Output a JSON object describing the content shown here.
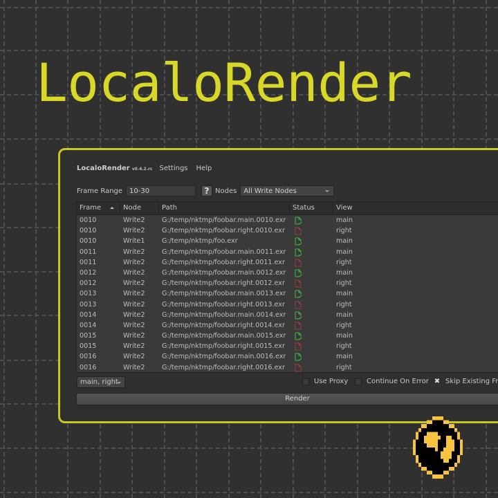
{
  "hero": {
    "title": "LocaloRender"
  },
  "menubar": {
    "app_name": "LocaloRender",
    "version": "v0.4.2.rc",
    "items": [
      "Settings",
      "Help"
    ]
  },
  "controls": {
    "frame_range_label": "Frame Range",
    "frame_range_value": "10-30",
    "help_label": "?",
    "nodes_label": "Nodes",
    "nodes_selected": "All Write Nodes"
  },
  "table": {
    "columns": [
      "Frame",
      "Node",
      "Path",
      "Status",
      "View"
    ],
    "sort_column": "Frame",
    "sort_direction": "ascending",
    "rows": [
      {
        "frame": "0010",
        "node": "Write2",
        "path": "G:/temp/nktmp/foobar.main.0010.exr",
        "status": "done",
        "view": "main"
      },
      {
        "frame": "0010",
        "node": "Write2",
        "path": "G:/temp/nktmp/foobar.right.0010.exr",
        "status": "missing",
        "view": "right"
      },
      {
        "frame": "0010",
        "node": "Write1",
        "path": "G:/temp/nktmp/foo.exr",
        "status": "done",
        "view": "main"
      },
      {
        "frame": "0011",
        "node": "Write2",
        "path": "G:/temp/nktmp/foobar.main.0011.exr",
        "status": "done",
        "view": "main"
      },
      {
        "frame": "0011",
        "node": "Write2",
        "path": "G:/temp/nktmp/foobar.right.0011.exr",
        "status": "missing",
        "view": "right"
      },
      {
        "frame": "0012",
        "node": "Write2",
        "path": "G:/temp/nktmp/foobar.main.0012.exr",
        "status": "done",
        "view": "main"
      },
      {
        "frame": "0012",
        "node": "Write2",
        "path": "G:/temp/nktmp/foobar.right.0012.exr",
        "status": "missing",
        "view": "right"
      },
      {
        "frame": "0013",
        "node": "Write2",
        "path": "G:/temp/nktmp/foobar.main.0013.exr",
        "status": "done",
        "view": "main"
      },
      {
        "frame": "0013",
        "node": "Write2",
        "path": "G:/temp/nktmp/foobar.right.0013.exr",
        "status": "missing",
        "view": "right"
      },
      {
        "frame": "0014",
        "node": "Write2",
        "path": "G:/temp/nktmp/foobar.main.0014.exr",
        "status": "done",
        "view": "main"
      },
      {
        "frame": "0014",
        "node": "Write2",
        "path": "G:/temp/nktmp/foobar.right.0014.exr",
        "status": "missing",
        "view": "right"
      },
      {
        "frame": "0015",
        "node": "Write2",
        "path": "G:/temp/nktmp/foobar.main.0015.exr",
        "status": "done",
        "view": "main"
      },
      {
        "frame": "0015",
        "node": "Write2",
        "path": "G:/temp/nktmp/foobar.right.0015.exr",
        "status": "missing",
        "view": "right"
      },
      {
        "frame": "0016",
        "node": "Write2",
        "path": "G:/temp/nktmp/foobar.main.0016.exr",
        "status": "done",
        "view": "main"
      },
      {
        "frame": "0016",
        "node": "Write2",
        "path": "G:/temp/nktmp/foobar.right.0016.exr",
        "status": "missing",
        "view": "right"
      }
    ]
  },
  "status_icons": {
    "done": "file-check-icon",
    "missing": "file-missing-icon"
  },
  "colors": {
    "accent": "#d8d82a",
    "done": "#3dbb3d",
    "missing": "#c03a3a",
    "logo": "#f8c440"
  },
  "bottom": {
    "views_selected": "main, right",
    "use_proxy_label": "Use Proxy",
    "use_proxy_checked": false,
    "continue_on_error_label": "Continue On Error",
    "continue_on_error_checked": false,
    "skip_existing_label": "Skip Existing Fra",
    "skip_existing_checked": true,
    "render_label": "Render"
  }
}
